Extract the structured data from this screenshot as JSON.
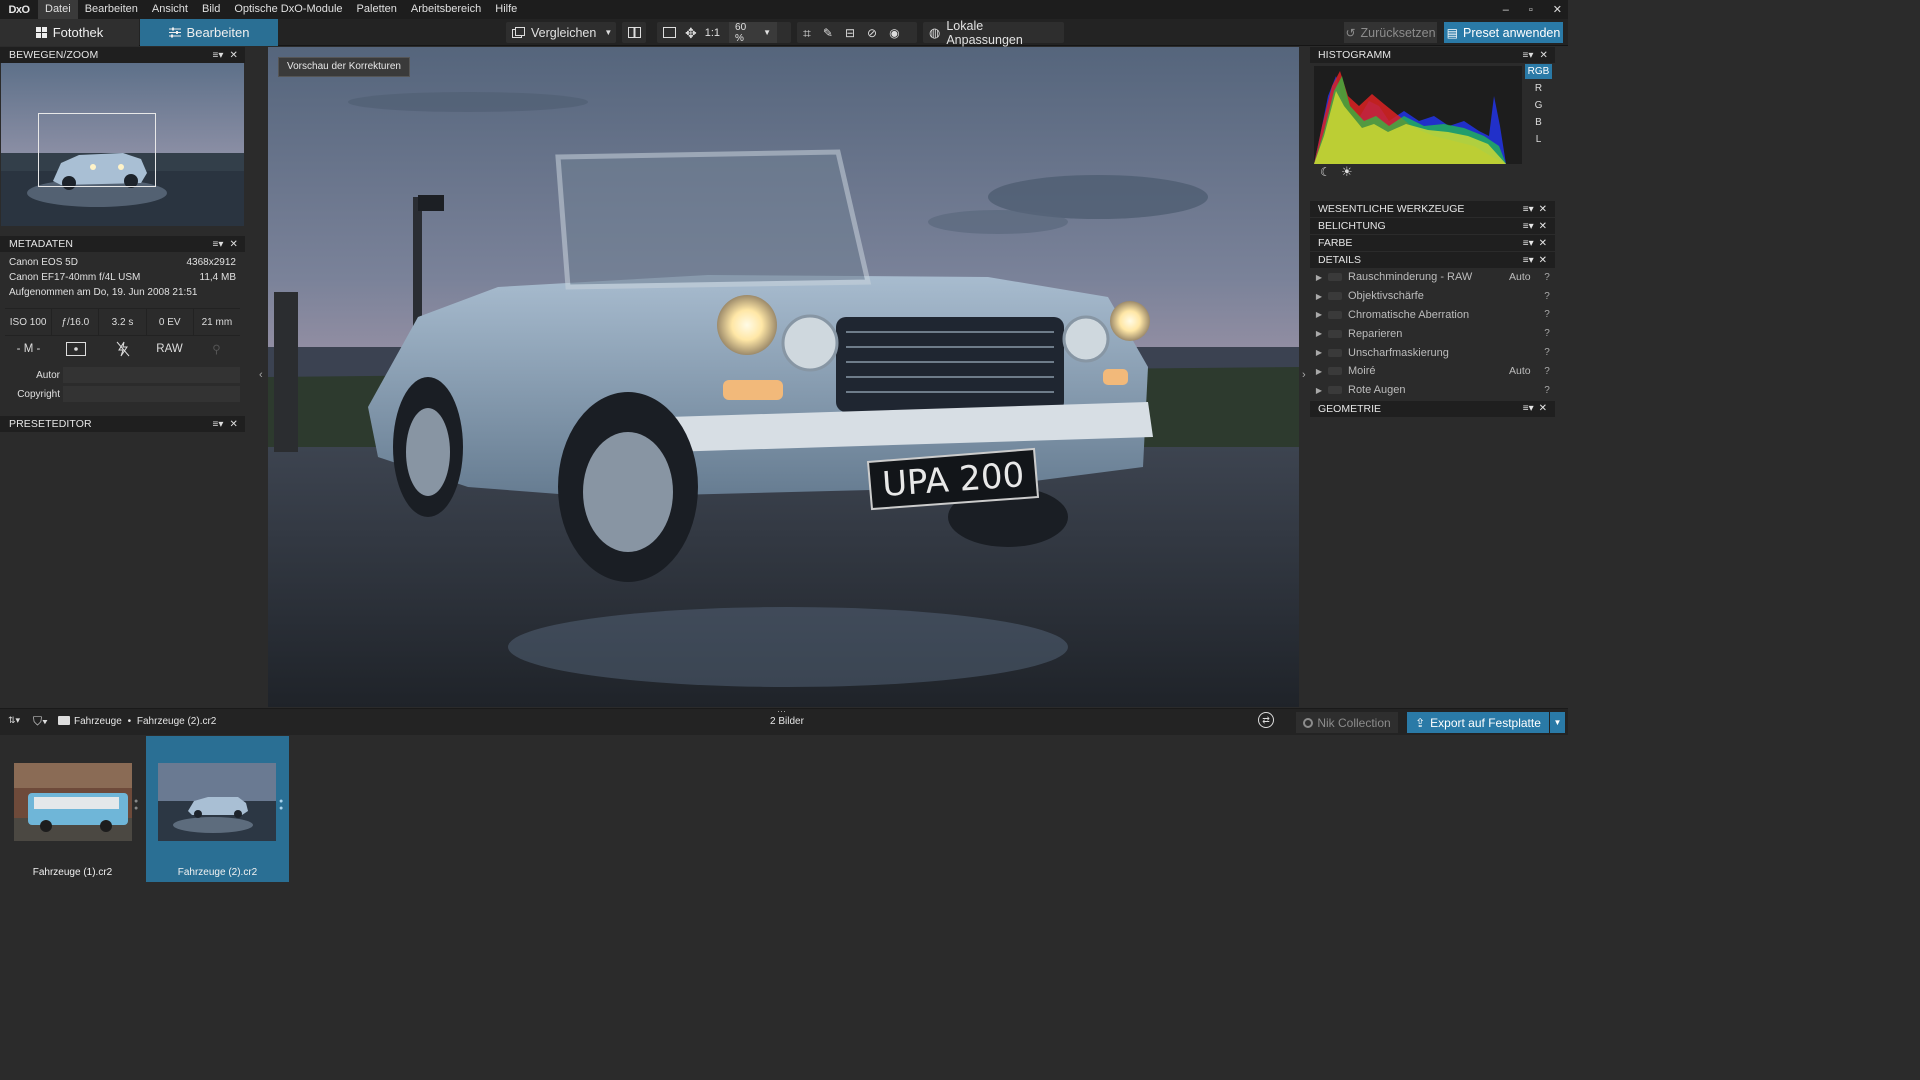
{
  "menubar": {
    "logo": "DxO",
    "items": [
      "Datei",
      "Bearbeiten",
      "Ansicht",
      "Bild",
      "Optische DxO-Module",
      "Paletten",
      "Arbeitsbereich",
      "Hilfe"
    ],
    "window_controls": [
      "–",
      "▫",
      "✕"
    ]
  },
  "toolbar": {
    "tab_library": "Fotothek",
    "tab_edit": "Bearbeiten",
    "compare_label": "Vergleichen",
    "one_to_one": "1:1",
    "zoom_value": "60 %",
    "local_adjustments": "Lokale Anpassungen",
    "reset_label": "Zurücksetzen",
    "apply_preset_label": "Preset anwenden"
  },
  "left_panel": {
    "move_zoom_title": "BEWEGEN/ZOOM",
    "metadata_title": "METADATEN",
    "camera": "Canon EOS 5D",
    "resolution": "4368x2912",
    "lens": "Canon EF17-40mm f/4L USM",
    "file_size": "11,4 MB",
    "captured": "Aufgenommen am Do, 19. Jun 2008 21:51",
    "exif": [
      "ISO 100",
      "ƒ/16.0",
      "3.2 s",
      "0 EV",
      "21 mm"
    ],
    "exposure_mode": "- M -",
    "raw_label": "RAW",
    "author_label": "Autor",
    "copyright_label": "Copyright",
    "author_value": "",
    "copyright_value": "",
    "preset_editor_title": "PRESETEDITOR"
  },
  "viewer": {
    "preview_label": "Vorschau der Korrekturen",
    "plate": "UPA 200"
  },
  "right_panel": {
    "histogram_title": "HISTOGRAMM",
    "channels": [
      "RGB",
      "R",
      "G",
      "B",
      "L"
    ],
    "sections": {
      "essential": "WESENTLICHE WERKZEUGE",
      "exposure": "BELICHTUNG",
      "color": "FARBE",
      "details": "DETAILS",
      "geometry": "GEOMETRIE"
    },
    "details_items": [
      {
        "label": "Rauschminderung - RAW",
        "value": "Auto"
      },
      {
        "label": "Objektivschärfe",
        "value": ""
      },
      {
        "label": "Chromatische Aberration",
        "value": ""
      },
      {
        "label": "Reparieren",
        "value": ""
      },
      {
        "label": "Unscharfmaskierung",
        "value": ""
      },
      {
        "label": "Moiré",
        "value": "Auto"
      },
      {
        "label": "Rote Augen",
        "value": ""
      }
    ]
  },
  "path_bar": {
    "folder": "Fahrzeuge",
    "separator": "•",
    "file": "Fahrzeuge (2).cr2",
    "count": "2 Bilder",
    "nik_label": "Nik Collection",
    "export_label": "Export auf Festplatte"
  },
  "filmstrip": [
    {
      "name": "Fahrzeuge (1).cr2",
      "selected": false
    },
    {
      "name": "Fahrzeuge (2).cr2",
      "selected": true
    }
  ],
  "colors": {
    "accent": "#2a7aa7",
    "tab_active": "#2a6f94",
    "panel_bg": "#2b2b2b",
    "header_bg": "#1f1f1f"
  }
}
